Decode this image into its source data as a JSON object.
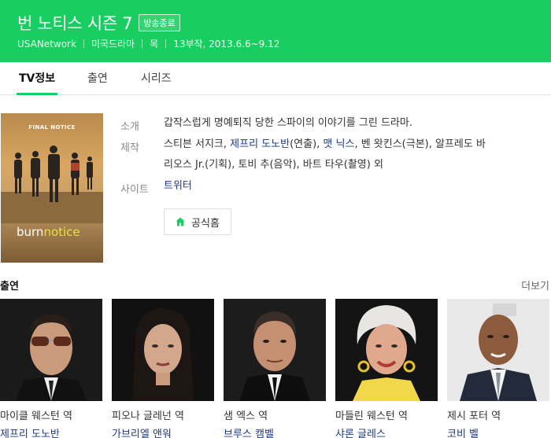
{
  "header": {
    "title": "번 노티스 시즌 7",
    "badge": "방송종료",
    "network": "USANetwork",
    "genre": "미국드라마",
    "day": "목",
    "episodes": "13부작, 2013.6.6~9.12"
  },
  "tabs": [
    {
      "label": "TV정보",
      "active": true
    },
    {
      "label": "출연",
      "active": false
    },
    {
      "label": "시리즈",
      "active": false
    }
  ],
  "poster": {
    "notice_text": "FINAL NOTICE",
    "logo_text_a": "burn",
    "logo_text_b": "notice"
  },
  "info": {
    "intro_label": "소개",
    "intro_text": "갑작스럽게 명예퇴직 당한 스파이의 이야기를 그린 드라마.",
    "crew_label": "제작",
    "crew_line1_a": "스티븐 서지크, ",
    "crew_line1_link": "제프리 도노반",
    "crew_line1_b": "(연출), ",
    "crew_line1_link2": "맷 닉스",
    "crew_line1_c": ", 벤 왓킨스(극본), 알프레도 바",
    "crew_line2": "리오스 Jr.(기획), 토비 추(음악), 바트 타우(촬영) 외",
    "site_label": "사이트",
    "site_link": "트위터",
    "home_button": "공식홈"
  },
  "cast": {
    "title": "출연",
    "more": "더보기",
    "members": [
      {
        "role": "마이클 웨스턴 역",
        "actor": "제프리 도노반"
      },
      {
        "role": "피오나 글레넌 역",
        "actor": "가브리엘 앤워"
      },
      {
        "role": "샘 엑스 역",
        "actor": "브루스 캠벨"
      },
      {
        "role": "마들린 웨스턴 역",
        "actor": "샤론 글레스"
      },
      {
        "role": "제시 포터 역",
        "actor": "코비 벨"
      }
    ]
  },
  "colors": {
    "header_green": "#19ce60",
    "link_blue": "#1b3a8a"
  }
}
